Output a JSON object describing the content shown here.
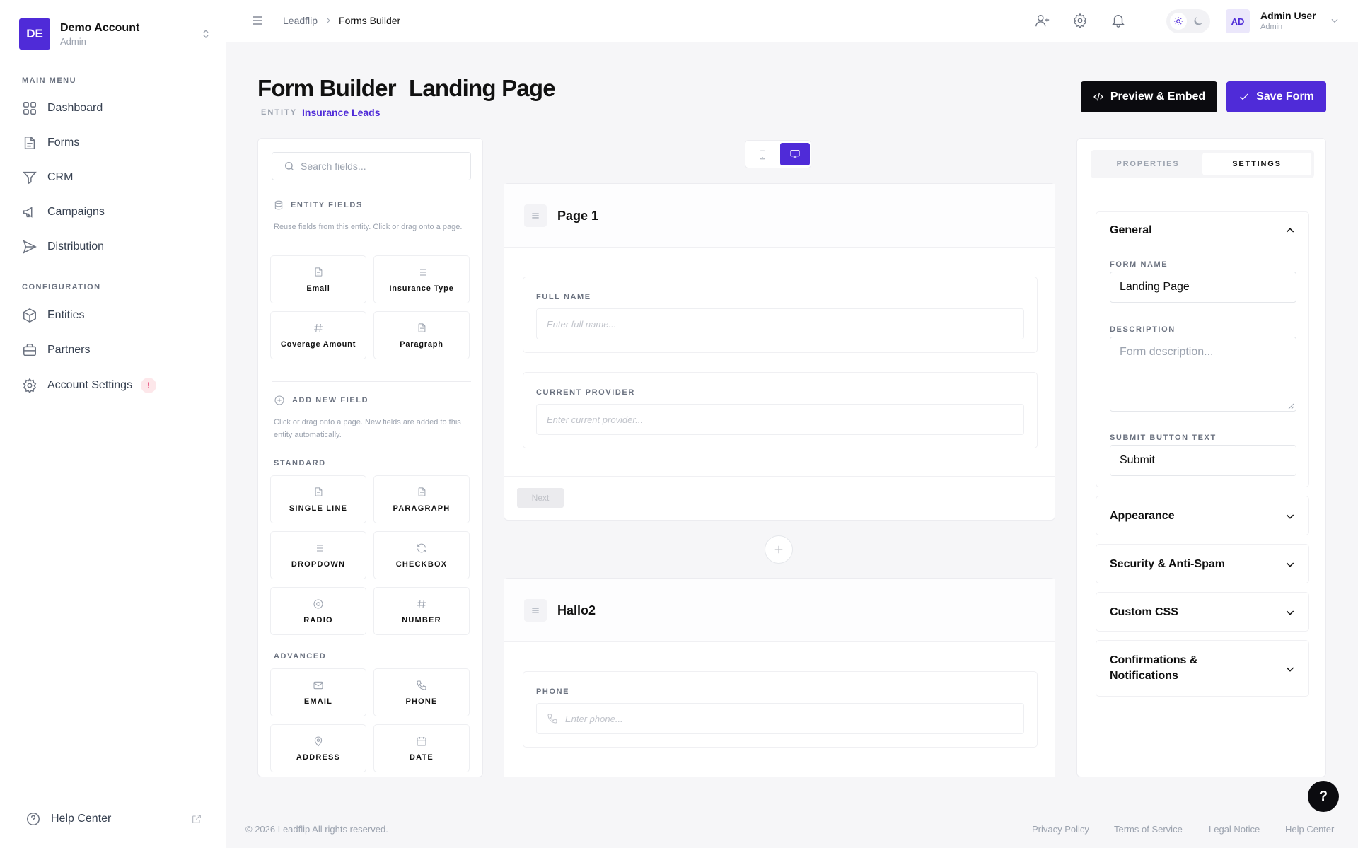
{
  "account": {
    "initials": "DE",
    "name": "Demo Account",
    "role": "Admin"
  },
  "sidebar": {
    "main_menu_label": "MAIN MENU",
    "main_items": [
      {
        "label": "Dashboard",
        "icon": "grid-icon"
      },
      {
        "label": "Forms",
        "icon": "file-icon"
      },
      {
        "label": "CRM",
        "icon": "filter-icon"
      },
      {
        "label": "Campaigns",
        "icon": "megaphone-icon"
      },
      {
        "label": "Distribution",
        "icon": "send-icon"
      }
    ],
    "config_label": "CONFIGURATION",
    "config_items": [
      {
        "label": "Entities",
        "icon": "box-icon"
      },
      {
        "label": "Partners",
        "icon": "briefcase-icon"
      },
      {
        "label": "Account Settings",
        "icon": "gear-icon",
        "badge": "!"
      }
    ],
    "help_label": "Help Center"
  },
  "topbar": {
    "breadcrumb": [
      "Leadflip",
      "Forms Builder"
    ],
    "user": {
      "initials": "AD",
      "name": "Admin User",
      "role": "Admin"
    }
  },
  "header": {
    "title": "Form Builder",
    "form_name": "Landing Page",
    "entity_label": "ENTITY",
    "entity_value": "Insurance Leads",
    "preview_label": "Preview & Embed",
    "save_label": "Save Form"
  },
  "fields_panel": {
    "search_placeholder": "Search fields...",
    "entity_fields_title": "ENTITY FIELDS",
    "entity_fields_desc": "Reuse fields from this entity. Click or drag onto a page.",
    "entity_fields": [
      "Email",
      "Insurance Type",
      "Coverage Amount",
      "Paragraph"
    ],
    "add_new_title": "ADD NEW FIELD",
    "add_new_desc": "Click or drag onto a page. New fields are added to this entity automatically.",
    "standard_label": "STANDARD",
    "standard_fields": [
      "SINGLE LINE",
      "PARAGRAPH",
      "DROPDOWN",
      "CHECKBOX",
      "RADIO",
      "NUMBER"
    ],
    "advanced_label": "ADVANCED",
    "advanced_fields": [
      "EMAIL",
      "PHONE",
      "ADDRESS",
      "DATE"
    ]
  },
  "canvas": {
    "pages": [
      {
        "title": "Page 1",
        "fields": [
          {
            "label": "FULL NAME",
            "placeholder": "Enter full name..."
          },
          {
            "label": "CURRENT PROVIDER",
            "placeholder": "Enter current provider..."
          }
        ],
        "next_label": "Next"
      },
      {
        "title": "Hallo2",
        "fields": [
          {
            "label": "PHONE",
            "placeholder": "Enter phone..."
          }
        ]
      }
    ]
  },
  "settings_panel": {
    "tabs": [
      "PROPERTIES",
      "SETTINGS"
    ],
    "active_tab": "SETTINGS",
    "general_title": "General",
    "form_name_label": "FORM NAME",
    "form_name_value": "Landing Page",
    "description_label": "DESCRIPTION",
    "description_placeholder": "Form description...",
    "submit_label": "SUBMIT BUTTON TEXT",
    "submit_value": "Submit",
    "sections": [
      "Appearance",
      "Security & Anti-Spam",
      "Custom CSS",
      "Confirmations & Notifications"
    ]
  },
  "footer": {
    "copyright": "© 2026 Leadflip All rights reserved.",
    "links": [
      "Privacy Policy",
      "Terms of Service",
      "Legal Notice",
      "Help Center"
    ]
  },
  "colors": {
    "accent": "#4f2bd8",
    "dark": "#0b0b0f",
    "alert": "#e0245e"
  }
}
